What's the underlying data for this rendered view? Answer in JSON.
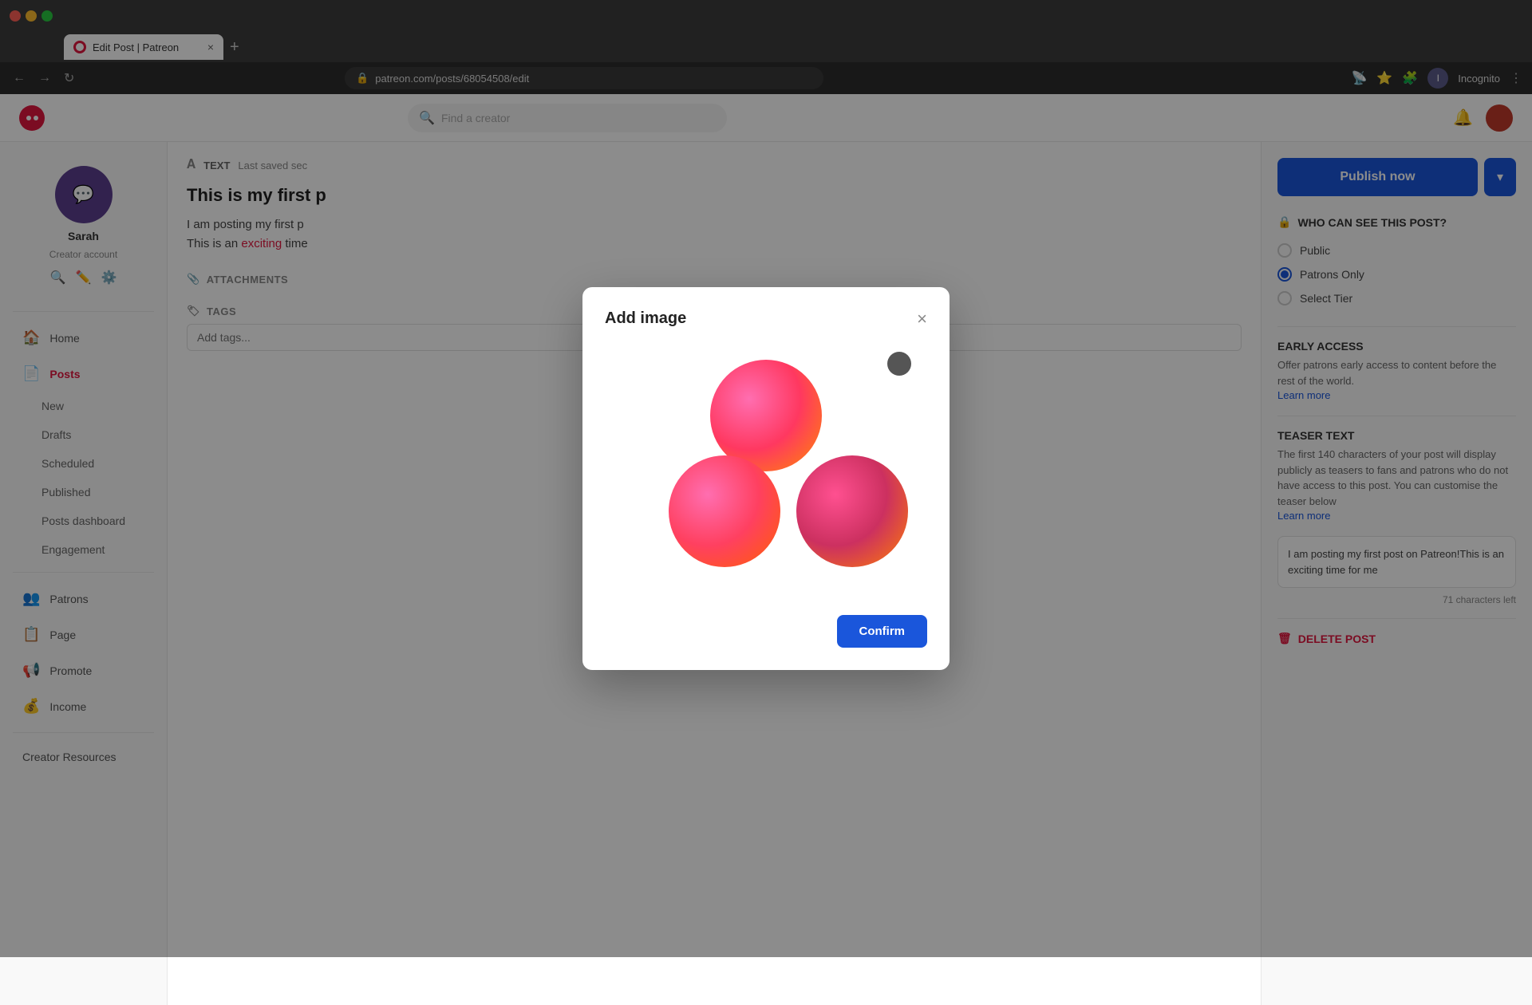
{
  "browser": {
    "tab_title": "Edit Post | Patreon",
    "url": "patreon.com/posts/68054508/edit",
    "new_tab_label": "+"
  },
  "topbar": {
    "search_placeholder": "Find a creator",
    "user_label": "Incognito"
  },
  "sidebar": {
    "profile_name": "Sarah",
    "profile_role": "Creator account",
    "nav_items": [
      {
        "label": "Home",
        "icon": "🏠"
      },
      {
        "label": "Posts",
        "icon": "📄",
        "active": true
      },
      {
        "label": "Patrons",
        "icon": "👥"
      },
      {
        "label": "Page",
        "icon": "📋"
      },
      {
        "label": "Promote",
        "icon": "📢"
      },
      {
        "label": "Income",
        "icon": "💰"
      }
    ],
    "posts_sub_items": [
      "New",
      "Drafts",
      "Scheduled",
      "Published",
      "Posts dashboard",
      "Engagement"
    ],
    "bottom_item": "Creator Resources"
  },
  "editor": {
    "section_label": "TEXT",
    "last_saved": "Last saved sec",
    "post_title": "This is my first p",
    "post_body_line1": "I am posting my first p",
    "post_body_line2": "This is an exciting time",
    "exciting_link": "exciting",
    "attachments_label": "ATTACHMENTS",
    "tags_label": "TAGS",
    "tags_placeholder": "Add tags..."
  },
  "right_panel": {
    "publish_btn": "Publish now",
    "dropdown_arrow": "▾",
    "visibility_title": "WHO CAN SEE THIS POST?",
    "visibility_options": [
      "Public",
      "Patrons Only",
      "Select Tier"
    ],
    "selected_option": "Patrons Only",
    "early_access_title": "EARLY ACCESS",
    "early_access_text": "Offer patrons early access to content before the rest of the world.",
    "early_access_link": "Learn more",
    "teaser_title": "TEASER TEXT",
    "teaser_description": "The first 140 characters of your post will display publicly as teasers to fans and patrons who do not have access to this post. You can customise the teaser below",
    "teaser_link": "Learn more",
    "teaser_content": "I am posting my first post on Patreon!This is an exciting time for me",
    "char_count": "71 characters left",
    "delete_label": "DELETE POST"
  },
  "modal": {
    "title": "Add image",
    "close_label": "×",
    "confirm_btn": "Confirm"
  },
  "lock_icon": "🔒",
  "trash_icon": "🗑"
}
